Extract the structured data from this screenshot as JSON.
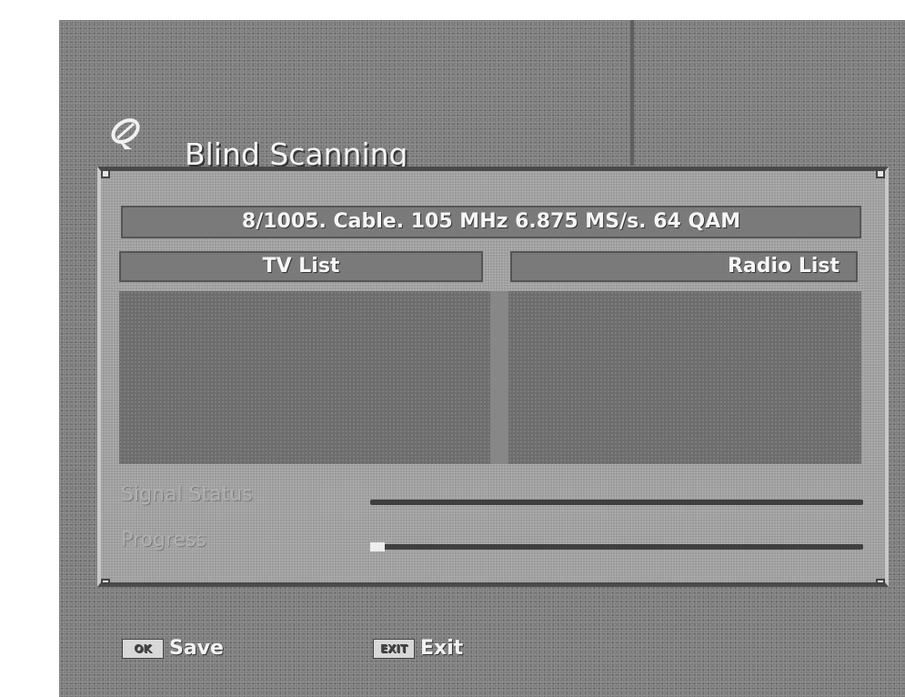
{
  "header": {
    "title": "Blind Scanning",
    "icon": "satellite-dish-icon"
  },
  "scan_info": "8/1005. Cable. 105 MHz 6.875 MS/s. 64 QAM",
  "lists": {
    "tv_label": "TV List",
    "radio_label": "Radio List"
  },
  "status": {
    "signal_label": "Signal Status",
    "progress_label": "Progress",
    "signal_level": 0,
    "progress_level": 0.03
  },
  "footer": {
    "save_label": "Save",
    "exit_label": "Exit"
  }
}
